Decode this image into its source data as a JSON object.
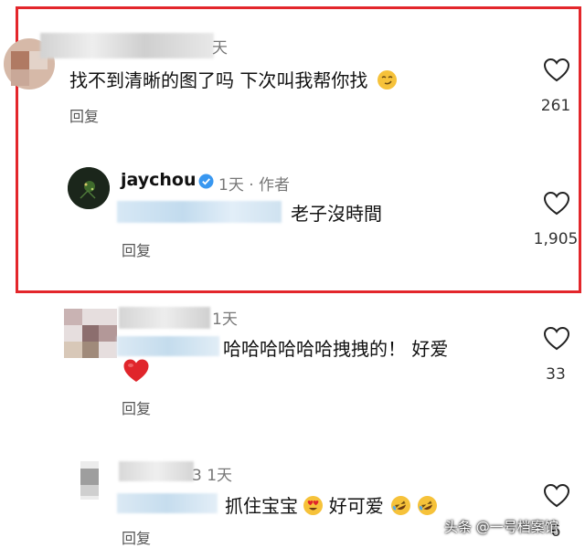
{
  "comments": [
    {
      "time": "天",
      "text": "找不到清晰的图了吗 下次叫我帮你找",
      "reply_label": "回复",
      "likes": "261"
    },
    {
      "username": "jaychou",
      "time": "1天 · 作者",
      "text": "老子沒時間",
      "reply_label": "回复",
      "likes": "1,905"
    },
    {
      "time": "1天",
      "text": "哈哈哈哈哈哈拽拽的！ 好爱",
      "reply_label": "回复",
      "likes": "33"
    },
    {
      "time": "3 1天",
      "text_a": "抓住宝宝",
      "text_b": "好可爱",
      "reply_label": "回复",
      "likes": "6"
    }
  ],
  "watermark": "头条 @一号档案馆",
  "icons": {
    "like": "heart-outline-icon",
    "verified": "verified-badge-icon",
    "smirk": "smirk-emoji",
    "red_heart": "red-heart-emoji",
    "heart_eyes": "heart-eyes-emoji",
    "laugh": "rolling-laughing-emoji"
  },
  "colors": {
    "highlight_border": "#e3262b",
    "verified": "#3897f0"
  }
}
